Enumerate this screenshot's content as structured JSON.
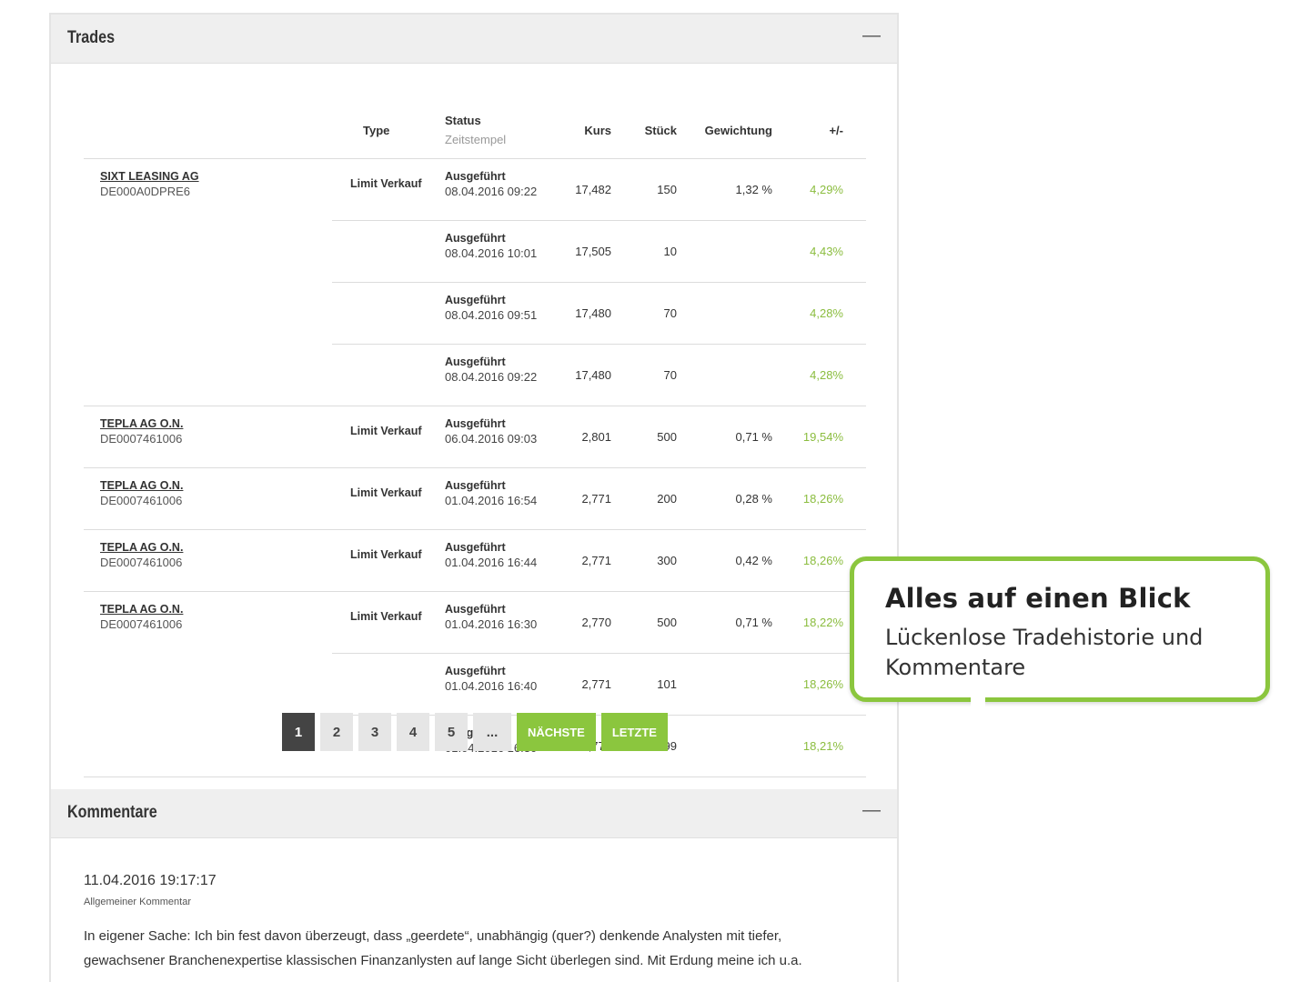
{
  "trades_section": {
    "title": "Trades",
    "collapse_symbol": "—",
    "columns": {
      "type": "Type",
      "status": "Status",
      "status_sub": "Zeitstempel",
      "kurs": "Kurs",
      "stueck": "Stück",
      "gewichtung": "Gewichtung",
      "change": "+/-"
    },
    "rows": [
      {
        "name": "SIXT LEASING AG",
        "isin": "DE000A0DPRE6",
        "type": "Limit Verkauf",
        "status": "Ausgeführt",
        "timestamp": "08.04.2016 09:22",
        "kurs": "17,482",
        "stueck": "150",
        "gewichtung": "1,32 %",
        "change": "4,29%"
      },
      {
        "name": "",
        "isin": "",
        "type": "",
        "status": "Ausgeführt",
        "timestamp": "08.04.2016 10:01",
        "kurs": "17,505",
        "stueck": "10",
        "gewichtung": "",
        "change": "4,43%"
      },
      {
        "name": "",
        "isin": "",
        "type": "",
        "status": "Ausgeführt",
        "timestamp": "08.04.2016 09:51",
        "kurs": "17,480",
        "stueck": "70",
        "gewichtung": "",
        "change": "4,28%"
      },
      {
        "name": "",
        "isin": "",
        "type": "",
        "status": "Ausgeführt",
        "timestamp": "08.04.2016 09:22",
        "kurs": "17,480",
        "stueck": "70",
        "gewichtung": "",
        "change": "4,28%"
      },
      {
        "name": "TEPLA AG O.N.",
        "isin": "DE0007461006",
        "type": "Limit Verkauf",
        "status": "Ausgeführt",
        "timestamp": "06.04.2016 09:03",
        "kurs": "2,801",
        "stueck": "500",
        "gewichtung": "0,71 %",
        "change": "19,54%"
      },
      {
        "name": "TEPLA AG O.N.",
        "isin": "DE0007461006",
        "type": "Limit Verkauf",
        "status": "Ausgeführt",
        "timestamp": "01.04.2016 16:54",
        "kurs": "2,771",
        "stueck": "200",
        "gewichtung": "0,28 %",
        "change": "18,26%"
      },
      {
        "name": "TEPLA AG O.N.",
        "isin": "DE0007461006",
        "type": "Limit Verkauf",
        "status": "Ausgeführt",
        "timestamp": "01.04.2016 16:44",
        "kurs": "2,771",
        "stueck": "300",
        "gewichtung": "0,42 %",
        "change": "18,26%"
      },
      {
        "name": "TEPLA AG O.N.",
        "isin": "DE0007461006",
        "type": "Limit Verkauf",
        "status": "Ausgeführt",
        "timestamp": "01.04.2016 16:30",
        "kurs": "2,770",
        "stueck": "500",
        "gewichtung": "0,71 %",
        "change": "18,22%"
      },
      {
        "name": "",
        "isin": "",
        "type": "",
        "status": "Ausgeführt",
        "timestamp": "01.04.2016 16:40",
        "kurs": "2,771",
        "stueck": "101",
        "gewichtung": "",
        "change": "18,26%"
      },
      {
        "name": "",
        "isin": "",
        "type": "",
        "status": "Ausgeführt",
        "timestamp": "01.04.2016 16:30",
        "kurs": "2,770",
        "stueck": "399",
        "gewichtung": "",
        "change": "18,21%"
      }
    ],
    "pagination": {
      "pages": [
        "1",
        "2",
        "3",
        "4",
        "5"
      ],
      "current": "1",
      "ellipsis": "...",
      "next": "NÄCHSTE",
      "last": "LETZTE"
    }
  },
  "comments_section": {
    "title": "Kommentare",
    "collapse_symbol": "—",
    "comment": {
      "date": "11.04.2016 19:17:17",
      "kind": "Allgemeiner Kommentar",
      "text": "In eigener Sache: Ich bin fest davon überzeugt, dass „geerdete“, unabhängig (quer?) denkende Analysten mit tiefer, gewachsener Branchenexpertise klassischen Finanzanlysten auf lange Sicht überlegen sind. Mit Erdung meine ich u.a."
    }
  },
  "callout": {
    "heading": "Alles auf einen Blick",
    "body": "Lückenlose Tradehistorie und Kommentare"
  },
  "colors": {
    "accent_green": "#8bc63e",
    "positive_text": "#8bbd3f",
    "active_page": "#444444"
  }
}
